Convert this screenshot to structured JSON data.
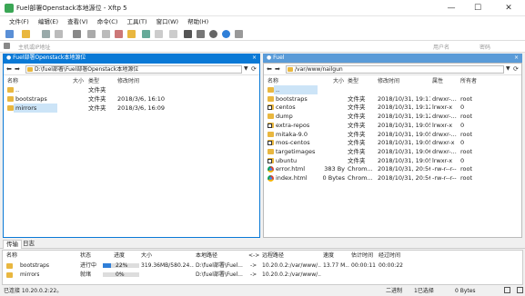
{
  "window": {
    "title": "Fuel部署Openstack本地源位 - Xftp 5",
    "minimize": "—",
    "maximize": "☐",
    "close": "✕"
  },
  "menu": [
    "文件(F)",
    "编辑(E)",
    "查看(V)",
    "命令(C)",
    "工具(T)",
    "窗口(W)",
    "帮助(H)"
  ],
  "addressbar": {
    "host_placeholder": "主机或IP地址",
    "user_placeholder": "用户名",
    "password_placeholder": "密码"
  },
  "left_tab": {
    "label": "● Fuel部署Openstack本地源位",
    "close": "×"
  },
  "right_tab": {
    "label": "● Fuel",
    "close": "×"
  },
  "left_pane": {
    "path": "D:\\fuel部署\\Fuel部署Openstack本地源位",
    "columns": {
      "name": "名称",
      "size": "大小",
      "type": "类型",
      "modified": "修改时间"
    },
    "rows": [
      {
        "name": "..",
        "size": "",
        "type": "文件夹",
        "modified": ""
      },
      {
        "name": "bootstraps",
        "size": "",
        "type": "文件夹",
        "modified": "2018/3/6, 16:10"
      },
      {
        "name": "mirrors",
        "size": "",
        "type": "文件夹",
        "modified": "2018/3/6, 16:09"
      }
    ]
  },
  "right_pane": {
    "path": "/var/www/nailgun",
    "columns": {
      "name": "名称",
      "size": "大小",
      "type": "类型",
      "modified": "修改时间",
      "attr": "属性",
      "owner": "所有者"
    },
    "rows": [
      {
        "name": "..",
        "size": "",
        "type": "",
        "modified": "",
        "attr": "",
        "owner": "",
        "icon": "folder-icon"
      },
      {
        "name": "bootstraps",
        "size": "",
        "type": "文件夹",
        "modified": "2018/10/31, 19:11",
        "attr": "drwxr-...",
        "owner": "root",
        "icon": "folder-icon"
      },
      {
        "name": "centos",
        "size": "",
        "type": "文件夹",
        "modified": "2018/10/31, 19:12",
        "attr": "lrwxr-x",
        "owner": "0",
        "icon": "link-folder-icon"
      },
      {
        "name": "dump",
        "size": "",
        "type": "文件夹",
        "modified": "2018/10/31, 19:12",
        "attr": "drwxr-...",
        "owner": "root",
        "icon": "folder-icon"
      },
      {
        "name": "extra-repos",
        "size": "",
        "type": "文件夹",
        "modified": "2018/10/31, 19:05",
        "attr": "lrwxr-x",
        "owner": "0",
        "icon": "link-folder-icon"
      },
      {
        "name": "mitaka-9.0",
        "size": "",
        "type": "文件夹",
        "modified": "2018/10/31, 19:05",
        "attr": "drwxr-...",
        "owner": "root",
        "icon": "folder-icon"
      },
      {
        "name": "mos-centos",
        "size": "",
        "type": "文件夹",
        "modified": "2018/10/31, 19:05",
        "attr": "drwxr-x",
        "owner": "0",
        "icon": "link-folder-icon"
      },
      {
        "name": "targetimages",
        "size": "",
        "type": "文件夹",
        "modified": "2018/10/31, 19:06",
        "attr": "drwxr-...",
        "owner": "root",
        "icon": "folder-icon"
      },
      {
        "name": "ubuntu",
        "size": "",
        "type": "文件夹",
        "modified": "2018/10/31, 19:05",
        "attr": "lrwxr-x",
        "owner": "0",
        "icon": "link-folder-icon"
      },
      {
        "name": "error.html",
        "size": "383 By",
        "type": "Chrom...",
        "modified": "2018/10/31, 20:56",
        "attr": "-rw-r--r--",
        "owner": "root",
        "icon": "chrome-icon"
      },
      {
        "name": "index.html",
        "size": "0 Bytes",
        "type": "Chrom...",
        "modified": "2018/10/31, 20:56",
        "attr": "-rw-r--r--",
        "owner": "root",
        "icon": "chrome-icon"
      }
    ]
  },
  "transfer": {
    "tabs": [
      "传输",
      "日志"
    ],
    "columns": {
      "name": "名称",
      "status": "状态",
      "progress": "进度",
      "size": "大小",
      "local": "本地路径",
      "arrow": "<->",
      "remote": "远程路径",
      "speed": "速度",
      "eta": "估计时间",
      "elapsed": "经过时间"
    },
    "rows": [
      {
        "name": "bootstraps",
        "status": "进行中",
        "progress": 0.22,
        "progress_text": "22%",
        "size": "319.36MB/580.24...",
        "local": "D:\\fuel部署\\Fuel...",
        "arrow": "->",
        "remote": "10.20.0.2:/var/www/...",
        "speed": "13.77 M...",
        "eta": "00:00:11",
        "elapsed": "00:00:22"
      },
      {
        "name": "mirrors",
        "status": "就绪",
        "progress": 0.0,
        "progress_text": "0%",
        "size": "",
        "local": "D:\\fuel部署\\Fuel...",
        "arrow": "->",
        "remote": "10.20.0.2:/var/www/...",
        "speed": "",
        "eta": "",
        "elapsed": ""
      }
    ]
  },
  "status": {
    "connection": "已连接 10.20.0.2:22。",
    "mode": "二进制",
    "selection": "1已选择",
    "size": "0 Bytes"
  },
  "colors": {
    "accent": "#0a79d6",
    "folder": "#e9b73f",
    "progress": "#2f7fd8",
    "selection": "#cce4f7"
  }
}
